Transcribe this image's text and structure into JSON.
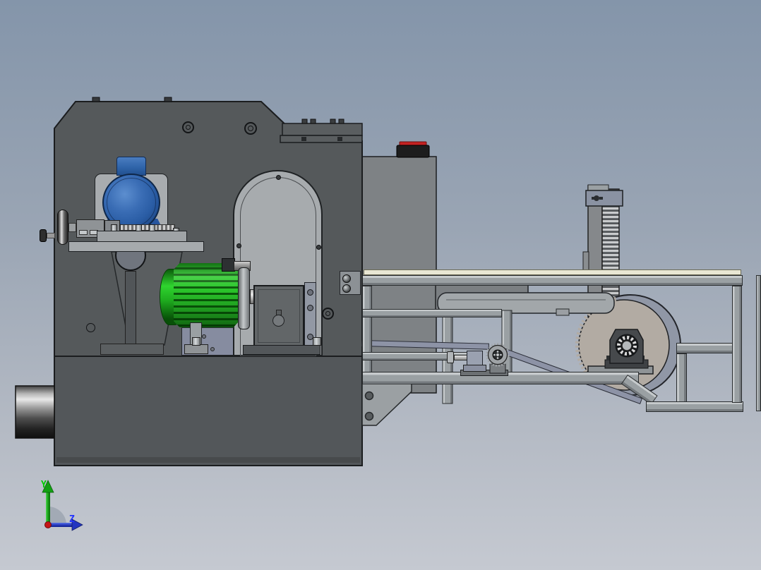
{
  "scene": {
    "description": "3D CAD assembly screenshot - sawing machine with feed frame, side view",
    "view_plane": "Y-Z"
  },
  "triad": {
    "y_label": "Y",
    "z_label": "Z",
    "y_color": "#00cc00",
    "z_color": "#2233ff",
    "x_origin_color": "#c41616"
  },
  "viewport": {
    "bg_top": "#8495aa",
    "bg_bottom": "#c5c9d1"
  },
  "palette": {
    "machine_body": "#55595b",
    "machine_base": "#53575a",
    "arch_cover": "#a7abae",
    "blue_motor": "#2e63a8",
    "green_motor": "#2bc62b",
    "gearbox": "#626668",
    "tank": "#7e8285",
    "tank_cap_red": "#c42222",
    "frame_tube": "#9aa0a3",
    "saw_blade": "#b2aba3",
    "blade_guard": "#9097a6",
    "bearing_block": "#46494c",
    "belt": "#8d93a6",
    "tabletop": "#e9e7d4",
    "rack_teeth_light": "#c9cbcd"
  },
  "components": [
    {
      "name": "machine-housing",
      "color": "#55595b"
    },
    {
      "name": "machine-base",
      "color": "#53575a"
    },
    {
      "name": "shaft-stub-cylinder",
      "color": "#9c9c9c"
    },
    {
      "name": "blue-motor",
      "color": "#2e63a8"
    },
    {
      "name": "handwheel-leadscrew",
      "color": "#8f9396"
    },
    {
      "name": "arch-cover",
      "color": "#a7abae"
    },
    {
      "name": "green-motor",
      "color": "#2bc62b"
    },
    {
      "name": "gearbox",
      "color": "#626668"
    },
    {
      "name": "coolant-tank",
      "color": "#7e8285"
    },
    {
      "name": "tank-cap",
      "color": "#c42222"
    },
    {
      "name": "conveyor-frame",
      "color": "#9aa0a3"
    },
    {
      "name": "gear-rack-tower",
      "color": "#85888b"
    },
    {
      "name": "saw-blade",
      "color": "#b2aba3"
    },
    {
      "name": "blade-guard",
      "color": "#9097a6"
    },
    {
      "name": "pillow-block-bearing",
      "color": "#46494c"
    },
    {
      "name": "drive-belt",
      "color": "#8d93a6"
    },
    {
      "name": "tension-sprocket",
      "color": "#9fa3a6"
    },
    {
      "name": "gusset-bracket",
      "color": "#9ba0a3"
    }
  ]
}
